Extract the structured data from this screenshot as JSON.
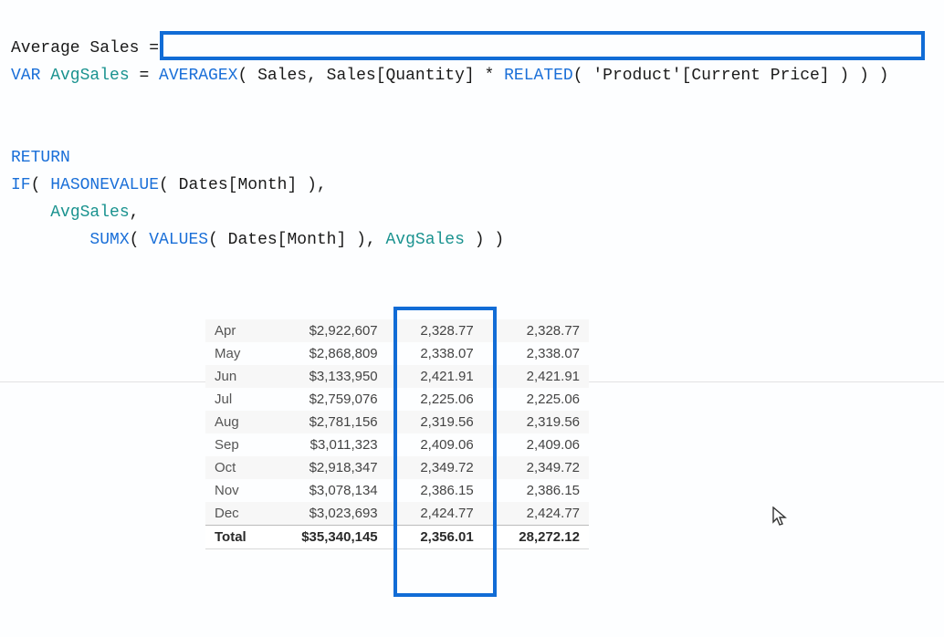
{
  "formula": {
    "line1_a": "Average Sales =",
    "line2_var": "VAR",
    "line2_name": " AvgSales ",
    "line2_eq": "= ",
    "line2_fn1": "AVERAGEX",
    "line2_p1": "( Sales, Sales[Quantity] * ",
    "line2_fn2": "RELATED",
    "line2_p2": "( 'Product'[Current Price] ) ) )",
    "line3_ret": "RETURN",
    "line4_fn1": "IF",
    "line4_p1": "( ",
    "line4_fn2": "HASONEVALUE",
    "line4_p2": "( Dates[Month] ),",
    "line5_indent": "    ",
    "line5_name": "AvgSales",
    "line5_c": ",",
    "line6_indent": "        ",
    "line6_fn1": "SUMX",
    "line6_p1": "( ",
    "line6_fn2": "VALUES",
    "line6_p2": "( Dates[Month] ), ",
    "line6_name": "AvgSales",
    "line6_p3": " ) )"
  },
  "table": {
    "rows": [
      {
        "m": "Apr",
        "sales": "$2,922,607",
        "c1": "2,328.77",
        "c2": "2,328.77"
      },
      {
        "m": "May",
        "sales": "$2,868,809",
        "c1": "2,338.07",
        "c2": "2,338.07"
      },
      {
        "m": "Jun",
        "sales": "$3,133,950",
        "c1": "2,421.91",
        "c2": "2,421.91"
      },
      {
        "m": "Jul",
        "sales": "$2,759,076",
        "c1": "2,225.06",
        "c2": "2,225.06"
      },
      {
        "m": "Aug",
        "sales": "$2,781,156",
        "c1": "2,319.56",
        "c2": "2,319.56"
      },
      {
        "m": "Sep",
        "sales": "$3,011,323",
        "c1": "2,409.06",
        "c2": "2,409.06"
      },
      {
        "m": "Oct",
        "sales": "$2,918,347",
        "c1": "2,349.72",
        "c2": "2,349.72"
      },
      {
        "m": "Nov",
        "sales": "$3,078,134",
        "c1": "2,386.15",
        "c2": "2,386.15"
      },
      {
        "m": "Dec",
        "sales": "$3,023,693",
        "c1": "2,424.77",
        "c2": "2,424.77"
      }
    ],
    "total": {
      "m": "Total",
      "sales": "$35,340,145",
      "c1": "2,356.01",
      "c2": "28,272.12"
    }
  }
}
